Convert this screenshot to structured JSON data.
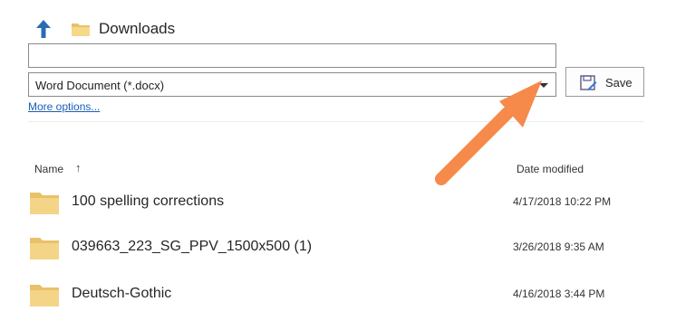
{
  "header": {
    "up_icon": "up-arrow-icon",
    "folder_icon": "folder-icon",
    "location": "Downloads"
  },
  "save_form": {
    "filename_value": "",
    "filetype_value": "Word Document (*.docx)",
    "save_label": "Save",
    "save_icon": "save-as-icon",
    "more_options_label": "More options..."
  },
  "file_list": {
    "columns": {
      "name": "Name",
      "name_sort_indicator": "↑",
      "date": "Date modified"
    },
    "rows": [
      {
        "name": "100 spelling corrections",
        "date": "4/17/2018 10:22 PM",
        "icon": "folder-icon"
      },
      {
        "name": "039663_223_SG_PPV_1500x500 (1)",
        "date": "3/26/2018 9:35 AM",
        "icon": "folder-icon"
      },
      {
        "name": "Deutsch-Gothic",
        "date": "4/16/2018 3:44 PM",
        "icon": "folder-icon"
      }
    ]
  },
  "annotation": {
    "arrow_color": "#f58a4b",
    "arrow_icon": "orange-pointer-arrow-icon"
  },
  "colors": {
    "link": "#1a5fb4",
    "folder": "#f0cf86",
    "up_arrow": "#2a6cb4"
  }
}
